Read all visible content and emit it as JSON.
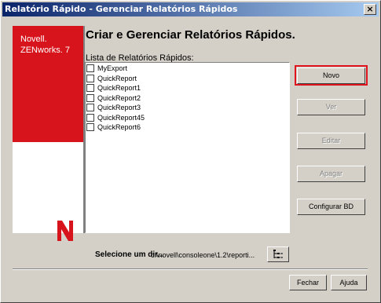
{
  "window": {
    "title": "Relatório Rápido - Gerenciar Relatórios Rápidos",
    "close_label": "×"
  },
  "banner": {
    "brand_line1": "Novell.",
    "brand_line2": "ZENworks. 7",
    "logo_icon": "novell-n-logo"
  },
  "heading": "Criar e Gerenciar Relatórios Rápidos.",
  "list": {
    "label": "Lista de Relatórios Rápidos:",
    "items": [
      {
        "label": "MyExport",
        "checked": false
      },
      {
        "label": "QuickReport",
        "checked": false
      },
      {
        "label": "QuickReport1",
        "checked": false
      },
      {
        "label": "QuickReport2",
        "checked": false
      },
      {
        "label": "QuickReport3",
        "checked": false
      },
      {
        "label": "QuickReport45",
        "checked": false
      },
      {
        "label": "QuickReport6",
        "checked": false
      }
    ]
  },
  "buttons": {
    "novo": "Novo",
    "ver": "Ver",
    "editar": "Editar",
    "apagar": "Apagar",
    "configurar": "Configurar BD"
  },
  "directory": {
    "label": "Selecione um dir...",
    "path": "c:\\novell\\consoleone\\1.2\\reporti...",
    "browse_icon": "folder-tree-icon"
  },
  "footer": {
    "fechar": "Fechar",
    "ajuda": "Ajuda"
  },
  "colors": {
    "title_start": "#0a246a",
    "title_end": "#a6caf0",
    "brand_red": "#d7141b",
    "focus_red": "#e0141e",
    "face": "#d4d0c8"
  }
}
